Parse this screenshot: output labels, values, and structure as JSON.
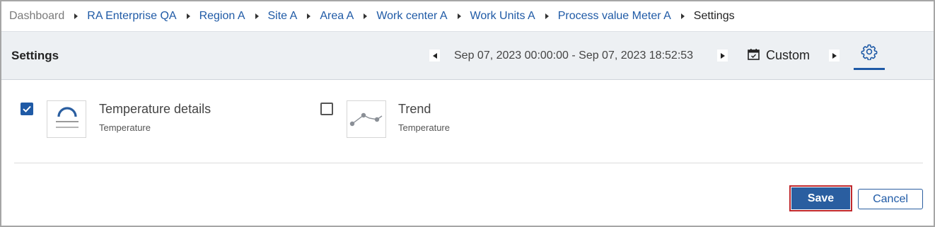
{
  "breadcrumb": {
    "items": [
      "Dashboard",
      "RA Enterprise QA",
      "Region A",
      "Site A",
      "Area A",
      "Work center A",
      "Work Units A",
      "Process value Meter A",
      "Settings"
    ]
  },
  "header": {
    "title": "Settings",
    "date_range": "Sep 07, 2023 00:00:00 - Sep 07, 2023 18:52:53",
    "range_mode": "Custom",
    "icons": [
      "prev-arrow",
      "next-arrow",
      "calendar-icon",
      "next-arrow",
      "gear-icon"
    ]
  },
  "widgets": [
    {
      "title": "Temperature details",
      "subtitle": "Temperature",
      "checked": true,
      "icon": "gauge-icon"
    },
    {
      "title": "Trend",
      "subtitle": "Temperature",
      "checked": false,
      "icon": "trend-line-icon"
    }
  ],
  "actions": {
    "save": "Save",
    "cancel": "Cancel"
  },
  "colors": {
    "accent": "#1f5aa6",
    "header_bg": "#edf0f3",
    "focus_outline": "#c0282c"
  }
}
